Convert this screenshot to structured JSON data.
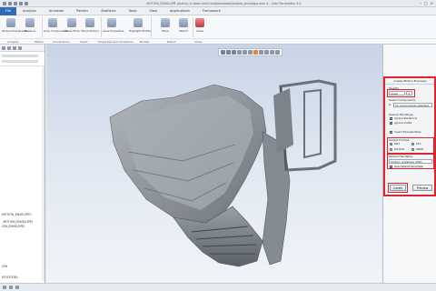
{
  "window": {
    "title": "MOTION_ENVELOPE (Active) in base.hm\\Creo\\Downloads\\motion_envelope.asm.4 - Creo Parametric 3.0"
  },
  "menubar": {
    "items": [
      "File",
      "Analysis",
      "Annotate",
      "Render",
      "Statistics",
      "Tools",
      "View",
      "Applications",
      "Framework"
    ]
  },
  "ribbon": {
    "buttons": [
      "Global Interference",
      "Measure",
      "Gray Components",
      "Ghost Tools",
      "Move Motion",
      "Save Properties",
      "Highlight Profile",
      "Move",
      "Sketch",
      "Close"
    ],
    "groups": [
      "Analysis",
      "Motion",
      "Connections",
      "Insert",
      "Properties and Conditions",
      "Bodies",
      "Datum",
      "Close"
    ]
  },
  "tree": {
    "items": [
      "MOTION_ENVELOPE)",
      "_MOTION_ENVELOPE)",
      "ION_ENVELOPE)",
      "ION",
      "(POSITION)",
      "S"
    ]
  },
  "dialog": {
    "title": "Create Motion Envelope",
    "quality_label": "Quality",
    "quality_value": "Level",
    "quality_num": "3",
    "components_label": "Select Components",
    "components_value": "72 components selected",
    "special_handlings_label": "Special Handlings",
    "ignore_skeletons": "Ignore Skeletons",
    "ignore_quilts": "Ignore Quilts",
    "invert_triangle": "Invert Triangle Pairs",
    "output_format_label": "Output Format",
    "format_part": "Part",
    "format_stl": "STL",
    "format_lw_part": "LW Part",
    "format_vrml": "VRML",
    "output_file_label": "Output File Name",
    "output_file_value": "motion_envelope_0001",
    "use_default_template": "Use default template",
    "create_button": "Create",
    "preview_button": "Preview"
  },
  "colors": {
    "highlight": "#e0232e",
    "model": "#8e939a",
    "viewport_top": "#c8d4e6",
    "viewport_bottom": "#f1f4f8"
  }
}
